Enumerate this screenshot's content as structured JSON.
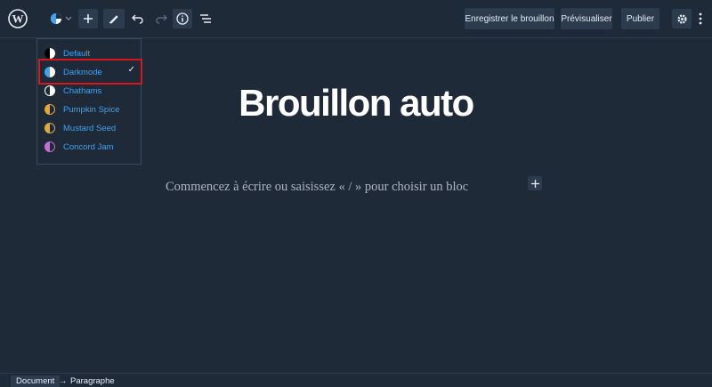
{
  "toolbar": {
    "logo": "wordpress-logo",
    "icons": [
      "style-switcher-icon",
      "add-block-icon",
      "edit-tool-icon",
      "undo-icon",
      "redo-icon",
      "info-icon",
      "list-view-icon"
    ],
    "save_draft_label": "Enregistrer le brouillon",
    "preview_label": "Prévisualiser",
    "publish_label": "Publier",
    "settings_icon": "gear-icon",
    "more_icon": "vertical-ellipsis-icon"
  },
  "theme_menu": {
    "items": [
      {
        "label": "Default",
        "colors": [
          "#000000",
          "#ffffff"
        ]
      },
      {
        "label": "Darkmode",
        "colors": [
          "#3ea3f5",
          "#ffffff"
        ],
        "selected": true
      },
      {
        "label": "Chathams",
        "colors": [
          "#1e2a38",
          "#ffffff"
        ]
      },
      {
        "label": "Pumpkin Spice",
        "colors": [
          "#e8a43a",
          "#1e2a38"
        ]
      },
      {
        "label": "Mustard Seed",
        "colors": [
          "#e0a93a",
          "#1e2a38"
        ]
      },
      {
        "label": "Concord Jam",
        "colors": [
          "#c86fd6",
          "#1e2a38"
        ]
      }
    ],
    "check_mark": "✓"
  },
  "editor": {
    "title": "Brouillon auto",
    "placeholder": "Commencez à écrire ou saisissez « / » pour choisir un bloc"
  },
  "status": {
    "crumb_document": "Document",
    "arrow": "→",
    "crumb_paragraph": "Paragraphe"
  },
  "colors": {
    "background": "#1e2a38",
    "accent": "#3ea3f5",
    "highlight_border": "#d9161a"
  }
}
